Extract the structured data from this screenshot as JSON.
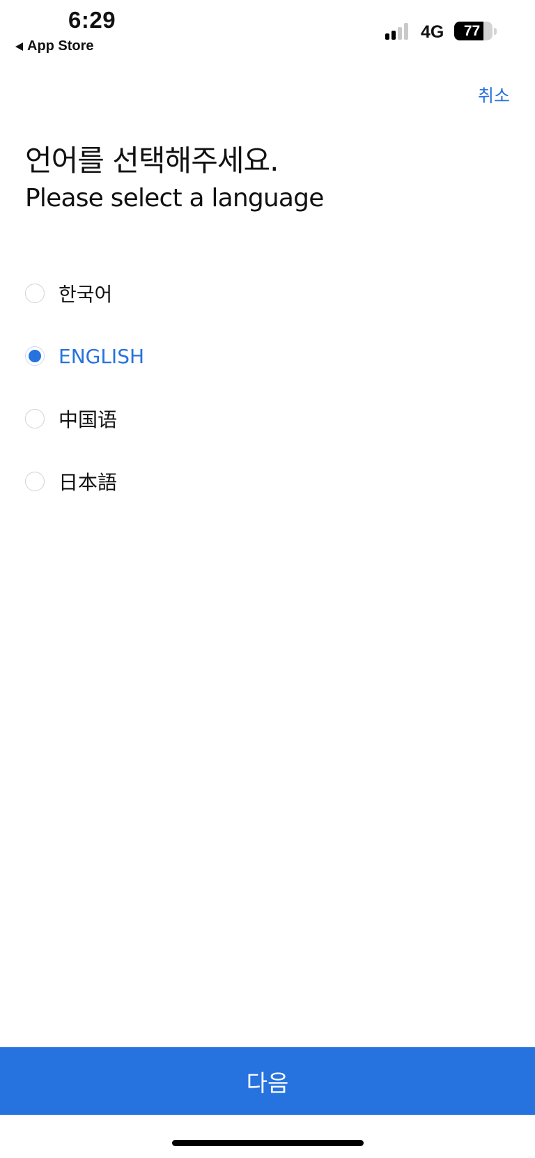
{
  "status_bar": {
    "time": "6:29",
    "back_label": "App Store",
    "network": "4G",
    "battery": "77",
    "battery_level": 0.77
  },
  "header": {
    "cancel_label": "취소"
  },
  "title": {
    "korean": "언어를 선택해주세요.",
    "english": "Please select a language"
  },
  "languages": [
    {
      "label": "한국어",
      "selected": false
    },
    {
      "label": "ENGLISH",
      "selected": true
    },
    {
      "label": "中国语",
      "selected": false
    },
    {
      "label": "日本語",
      "selected": false
    }
  ],
  "footer": {
    "next_label": "다음"
  },
  "colors": {
    "accent": "#2672de",
    "text": "#111111",
    "radio_border": "#d2d2d2"
  }
}
